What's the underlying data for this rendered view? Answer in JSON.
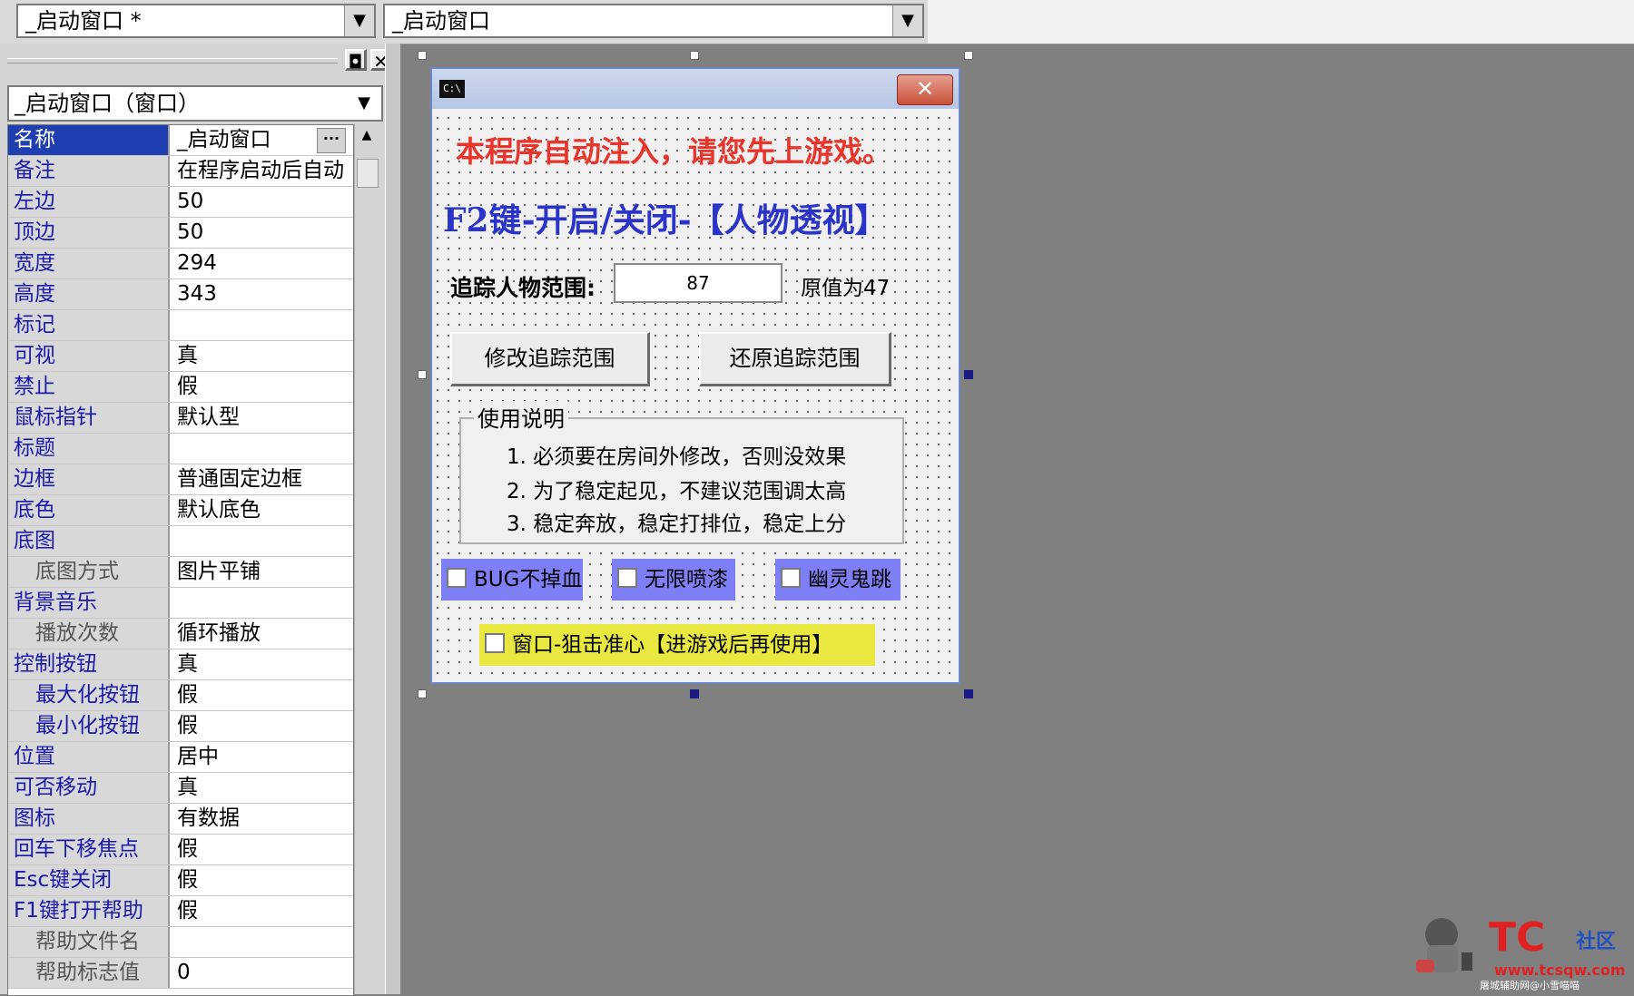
{
  "toolbar": {
    "combo1": "_启动窗口 *",
    "combo2": "_启动窗口"
  },
  "properties_panel": {
    "object_selector": "_启动窗口（窗口）",
    "rows": [
      {
        "key": "名称",
        "value": "_启动窗口",
        "selected": true
      },
      {
        "key": "备注",
        "value": "在程序启动后自动"
      },
      {
        "key": "左边",
        "value": "50"
      },
      {
        "key": "顶边",
        "value": "50"
      },
      {
        "key": "宽度",
        "value": "294"
      },
      {
        "key": "高度",
        "value": "343"
      },
      {
        "key": "标记",
        "value": ""
      },
      {
        "key": "可视",
        "value": "真"
      },
      {
        "key": "禁止",
        "value": "假"
      },
      {
        "key": "鼠标指针",
        "value": "默认型"
      },
      {
        "key": "标题",
        "value": ""
      },
      {
        "key": "边框",
        "value": "普通固定边框"
      },
      {
        "key": "底色",
        "value": "默认底色"
      },
      {
        "key": "底图",
        "value": ""
      },
      {
        "key": "底图方式",
        "value": "图片平铺"
      },
      {
        "key": "背景音乐",
        "value": ""
      },
      {
        "key": "播放次数",
        "value": "循环播放"
      },
      {
        "key": "控制按钮",
        "value": "真"
      },
      {
        "key": "最大化按钮",
        "value": "假"
      },
      {
        "key": "最小化按钮",
        "value": "假"
      },
      {
        "key": "位置",
        "value": "居中"
      },
      {
        "key": "可否移动",
        "value": "真"
      },
      {
        "key": "图标",
        "value": "有数据"
      },
      {
        "key": "回车下移焦点",
        "value": "假"
      },
      {
        "key": "Esc键关闭",
        "value": "假"
      },
      {
        "key": "F1键打开帮助",
        "value": "假"
      },
      {
        "key": "帮助文件名",
        "value": ""
      },
      {
        "key": "帮助标志值",
        "value": "0"
      }
    ]
  },
  "design_window": {
    "system_icon_text": "C:\\",
    "close_symbol": "✕",
    "label_inject": "本程序自动注入，请您先上游戏。",
    "label_hotkey": "F2键-开启/关闭-【人物透视】",
    "label_range": "追踪人物范围:",
    "range_value": "87",
    "label_original": "原值为47",
    "btn_modify": "修改追踪范围",
    "btn_restore": "还原追踪范围",
    "group_title": "使用说明",
    "instructions": [
      "1. 必须要在房间外修改，否则没效果",
      "2. 为了稳定起见，不建议范围调太高",
      "3. 稳定奔放，稳定打排位，稳定上分"
    ],
    "checkboxes": [
      {
        "label": "BUG不掉血",
        "color": "#7f7ff5"
      },
      {
        "label": "无限喷漆",
        "color": "#7f7ff5"
      },
      {
        "label": "幽灵鬼跳",
        "color": "#7f7ff5"
      }
    ],
    "sniper_checkbox": {
      "label": "窗口-狙击准心【进游戏后再使用】",
      "color": "#e8e840"
    }
  },
  "watermark": {
    "brand": "TC",
    "community": "社区",
    "url": "www.tcsqw.com",
    "caption": "屠城辅助网@小雪喵喵"
  }
}
